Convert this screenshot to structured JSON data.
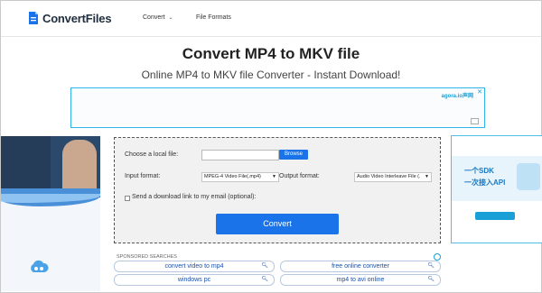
{
  "header": {
    "logo_text": "ConvertFiles",
    "nav": [
      {
        "label": "Convert",
        "icon": "chevron-down-icon"
      },
      {
        "label": "File Formats"
      }
    ]
  },
  "page": {
    "title": "Convert MP4 to MKV file",
    "subtitle": "Online MP4 to MKV file Converter - Instant Download!"
  },
  "ads": {
    "top_brand": "agora.io声网",
    "top_close": "✕",
    "right_line1": "一个SDK",
    "right_line2": "一次接入API"
  },
  "form": {
    "choose_label": "Choose a local file:",
    "browse_label": "Browse",
    "input_format_label": "Input format:",
    "input_format_value": "MPEG-4 Video File(.mp4)",
    "output_format_label": "Output format:",
    "output_format_value": "Audio Video Interleave File (.",
    "email_label": "Send a download link to my email (optional):",
    "convert_label": "Convert"
  },
  "sponsored": {
    "label": "SPONSORED SEARCHES",
    "items": [
      "convert video to mp4",
      "free online converter",
      "windows pc",
      "mp4 to avi online"
    ]
  },
  "colors": {
    "accent": "#1a73e8",
    "ad_border": "#2fb6e6"
  }
}
